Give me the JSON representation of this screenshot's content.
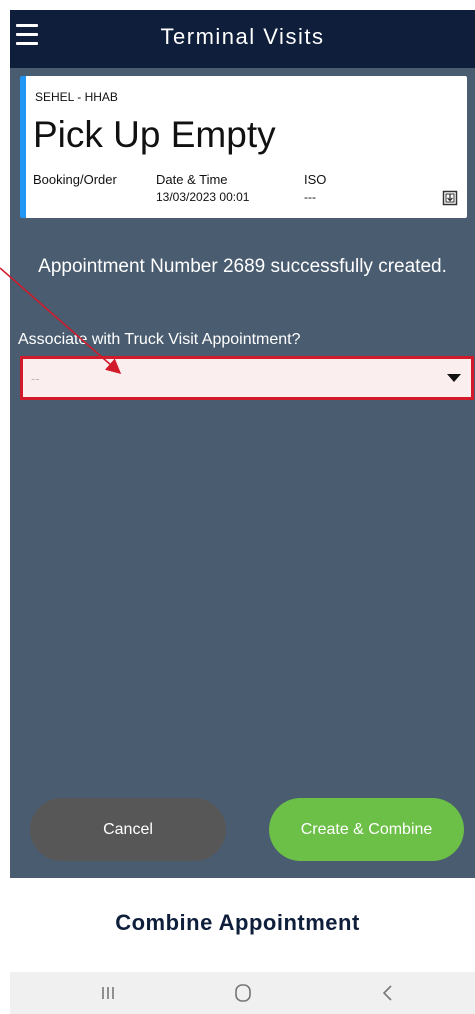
{
  "header": {
    "title": "Terminal Visits",
    "menu_icon": "hamburger-menu-icon"
  },
  "card": {
    "subtitle": "SEHEL - HHAB",
    "heading": "Pick Up Empty",
    "labels": {
      "booking": "Booking/Order",
      "datetime": "Date & Time",
      "iso": "ISO"
    },
    "values": {
      "booking": "",
      "datetime": "13/03/2023 00:01",
      "iso": "---"
    },
    "accent_color": "#2196f3",
    "icon": "export-icon"
  },
  "message": "Appointment Number 2689 successfully created.",
  "question": "Associate with Truck Visit Appointment?",
  "select": {
    "value": "--",
    "highlight_color": "#d11a2a",
    "icon": "chevron-down-icon"
  },
  "buttons": {
    "cancel": "Cancel",
    "create_combine": "Create & Combine",
    "create_color": "#6cbf47",
    "cancel_color": "#575757"
  },
  "caption": "Combine Appointment",
  "nav": {
    "recent": "recent-apps-icon",
    "home": "home-icon",
    "back": "back-icon"
  }
}
